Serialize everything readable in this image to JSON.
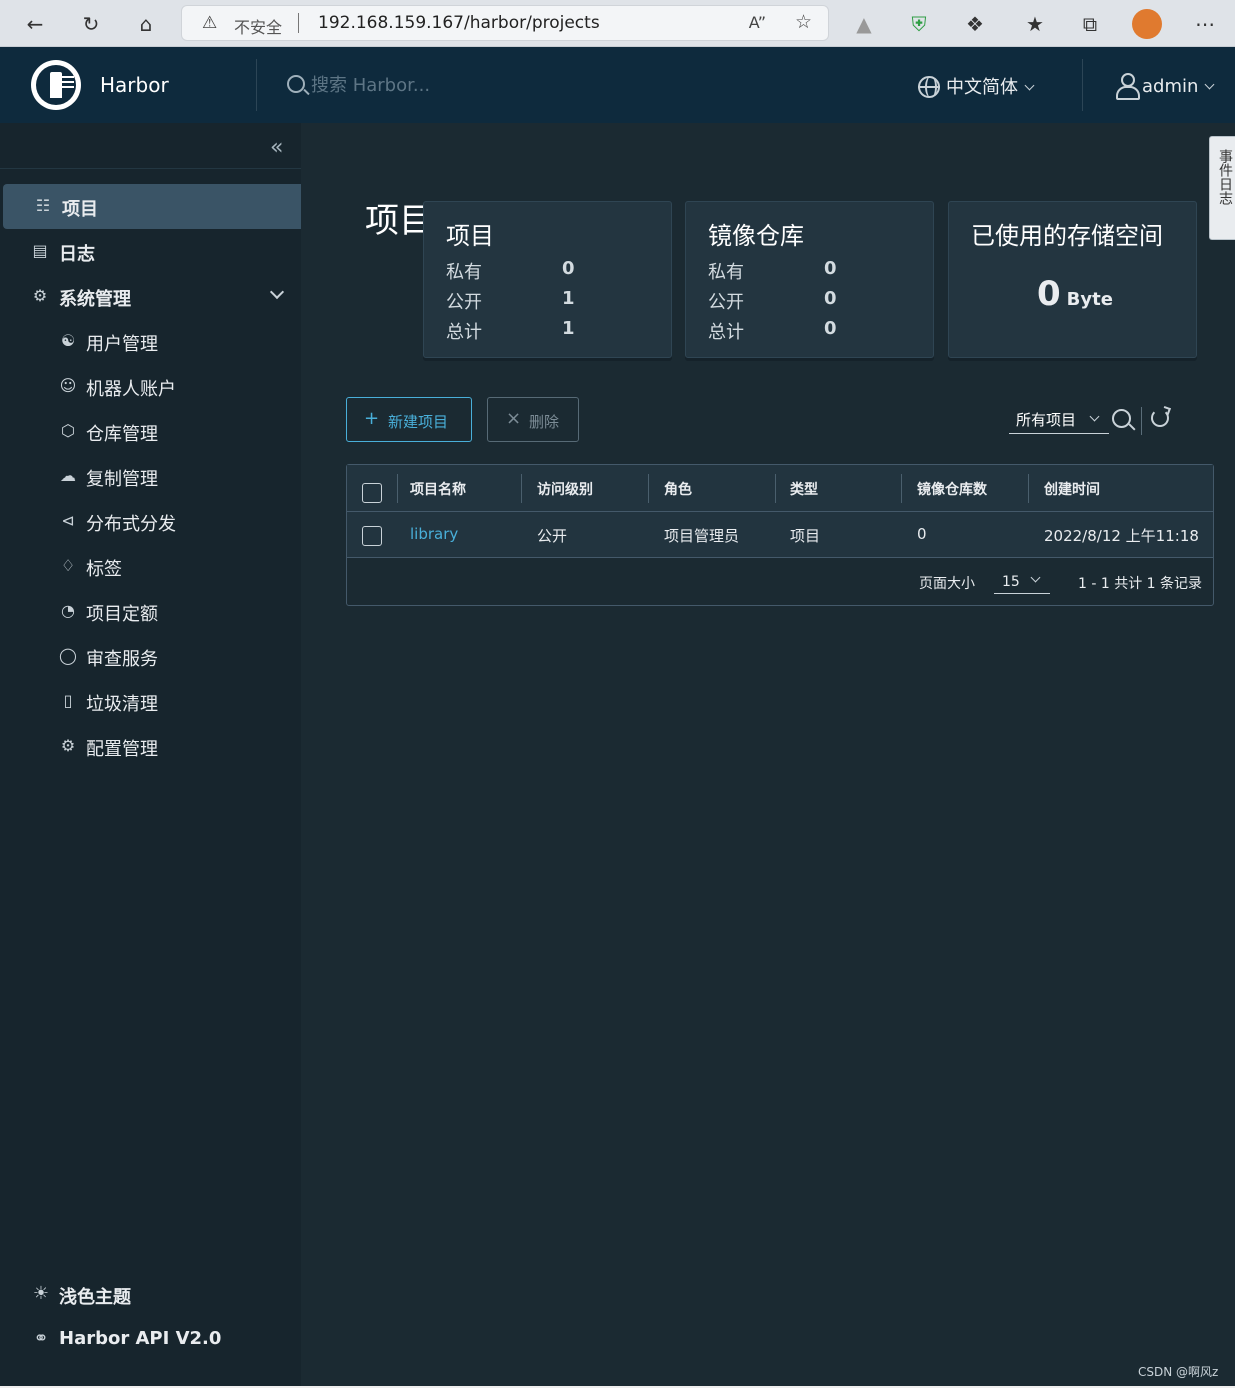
{
  "browser": {
    "insecure_label": "不安全",
    "url": "192.168.159.167/harbor/projects",
    "icons": [
      "back-icon",
      "reload-icon",
      "home-icon",
      "warning-icon",
      "read-aloud-icon",
      "add-favorite-icon",
      "extension-icon",
      "shield-extension-icon",
      "puzzle-icon",
      "favorites-icon",
      "collections-icon",
      "profile-avatar",
      "more-icon"
    ]
  },
  "header": {
    "brand": "Harbor",
    "search_placeholder": "搜索 Harbor...",
    "language": "中文简体",
    "user": "admin"
  },
  "sidebar": {
    "items": [
      {
        "label": "项目",
        "icon": "projects-icon"
      },
      {
        "label": "日志",
        "icon": "logs-icon"
      },
      {
        "label": "系统管理",
        "icon": "admin-icon"
      }
    ],
    "sub_items": [
      {
        "label": "用户管理",
        "icon": "users-icon"
      },
      {
        "label": "机器人账户",
        "icon": "robot-icon"
      },
      {
        "label": "仓库管理",
        "icon": "registry-icon"
      },
      {
        "label": "复制管理",
        "icon": "replication-icon"
      },
      {
        "label": "分布式分发",
        "icon": "distribution-icon"
      },
      {
        "label": "标签",
        "icon": "tag-icon"
      },
      {
        "label": "项目定额",
        "icon": "quota-icon"
      },
      {
        "label": "审查服务",
        "icon": "scanner-icon"
      },
      {
        "label": "垃圾清理",
        "icon": "trash-icon"
      },
      {
        "label": "配置管理",
        "icon": "config-icon"
      }
    ],
    "footer": {
      "theme": "浅色主题",
      "api": "Harbor API V2.0"
    }
  },
  "main": {
    "title": "项目",
    "cards": {
      "projects": {
        "title": "项目",
        "private_label": "私有",
        "private": "0",
        "public_label": "公开",
        "public": "1",
        "total_label": "总计",
        "total": "1"
      },
      "repos": {
        "title": "镜像仓库",
        "private_label": "私有",
        "private": "0",
        "public_label": "公开",
        "public": "0",
        "total_label": "总计",
        "total": "0"
      },
      "storage": {
        "title": "已使用的存储空间",
        "value": "0",
        "unit": "Byte"
      }
    },
    "toolbar": {
      "new_project": "新建项目",
      "delete": "删除",
      "filter": "所有项目"
    },
    "table": {
      "headers": [
        "项目名称",
        "访问级别",
        "角色",
        "类型",
        "镜像仓库数",
        "创建时间"
      ],
      "rows": [
        [
          "library",
          "公开",
          "项目管理员",
          "项目",
          "0",
          "2022/8/12 上午11:18"
        ]
      ],
      "page_size_label": "页面大小",
      "page_size": "15",
      "range": "1 - 1 共计 1 条记录"
    },
    "event_tab": "事件日志"
  },
  "watermark": "CSDN @啊风z",
  "colors": {
    "accent": "#49afd9",
    "header_bg": "#0e2a3d",
    "sidebar_bg": "#17252d",
    "active_nav": "#3a5466",
    "main_bg": "#1b2a32"
  }
}
